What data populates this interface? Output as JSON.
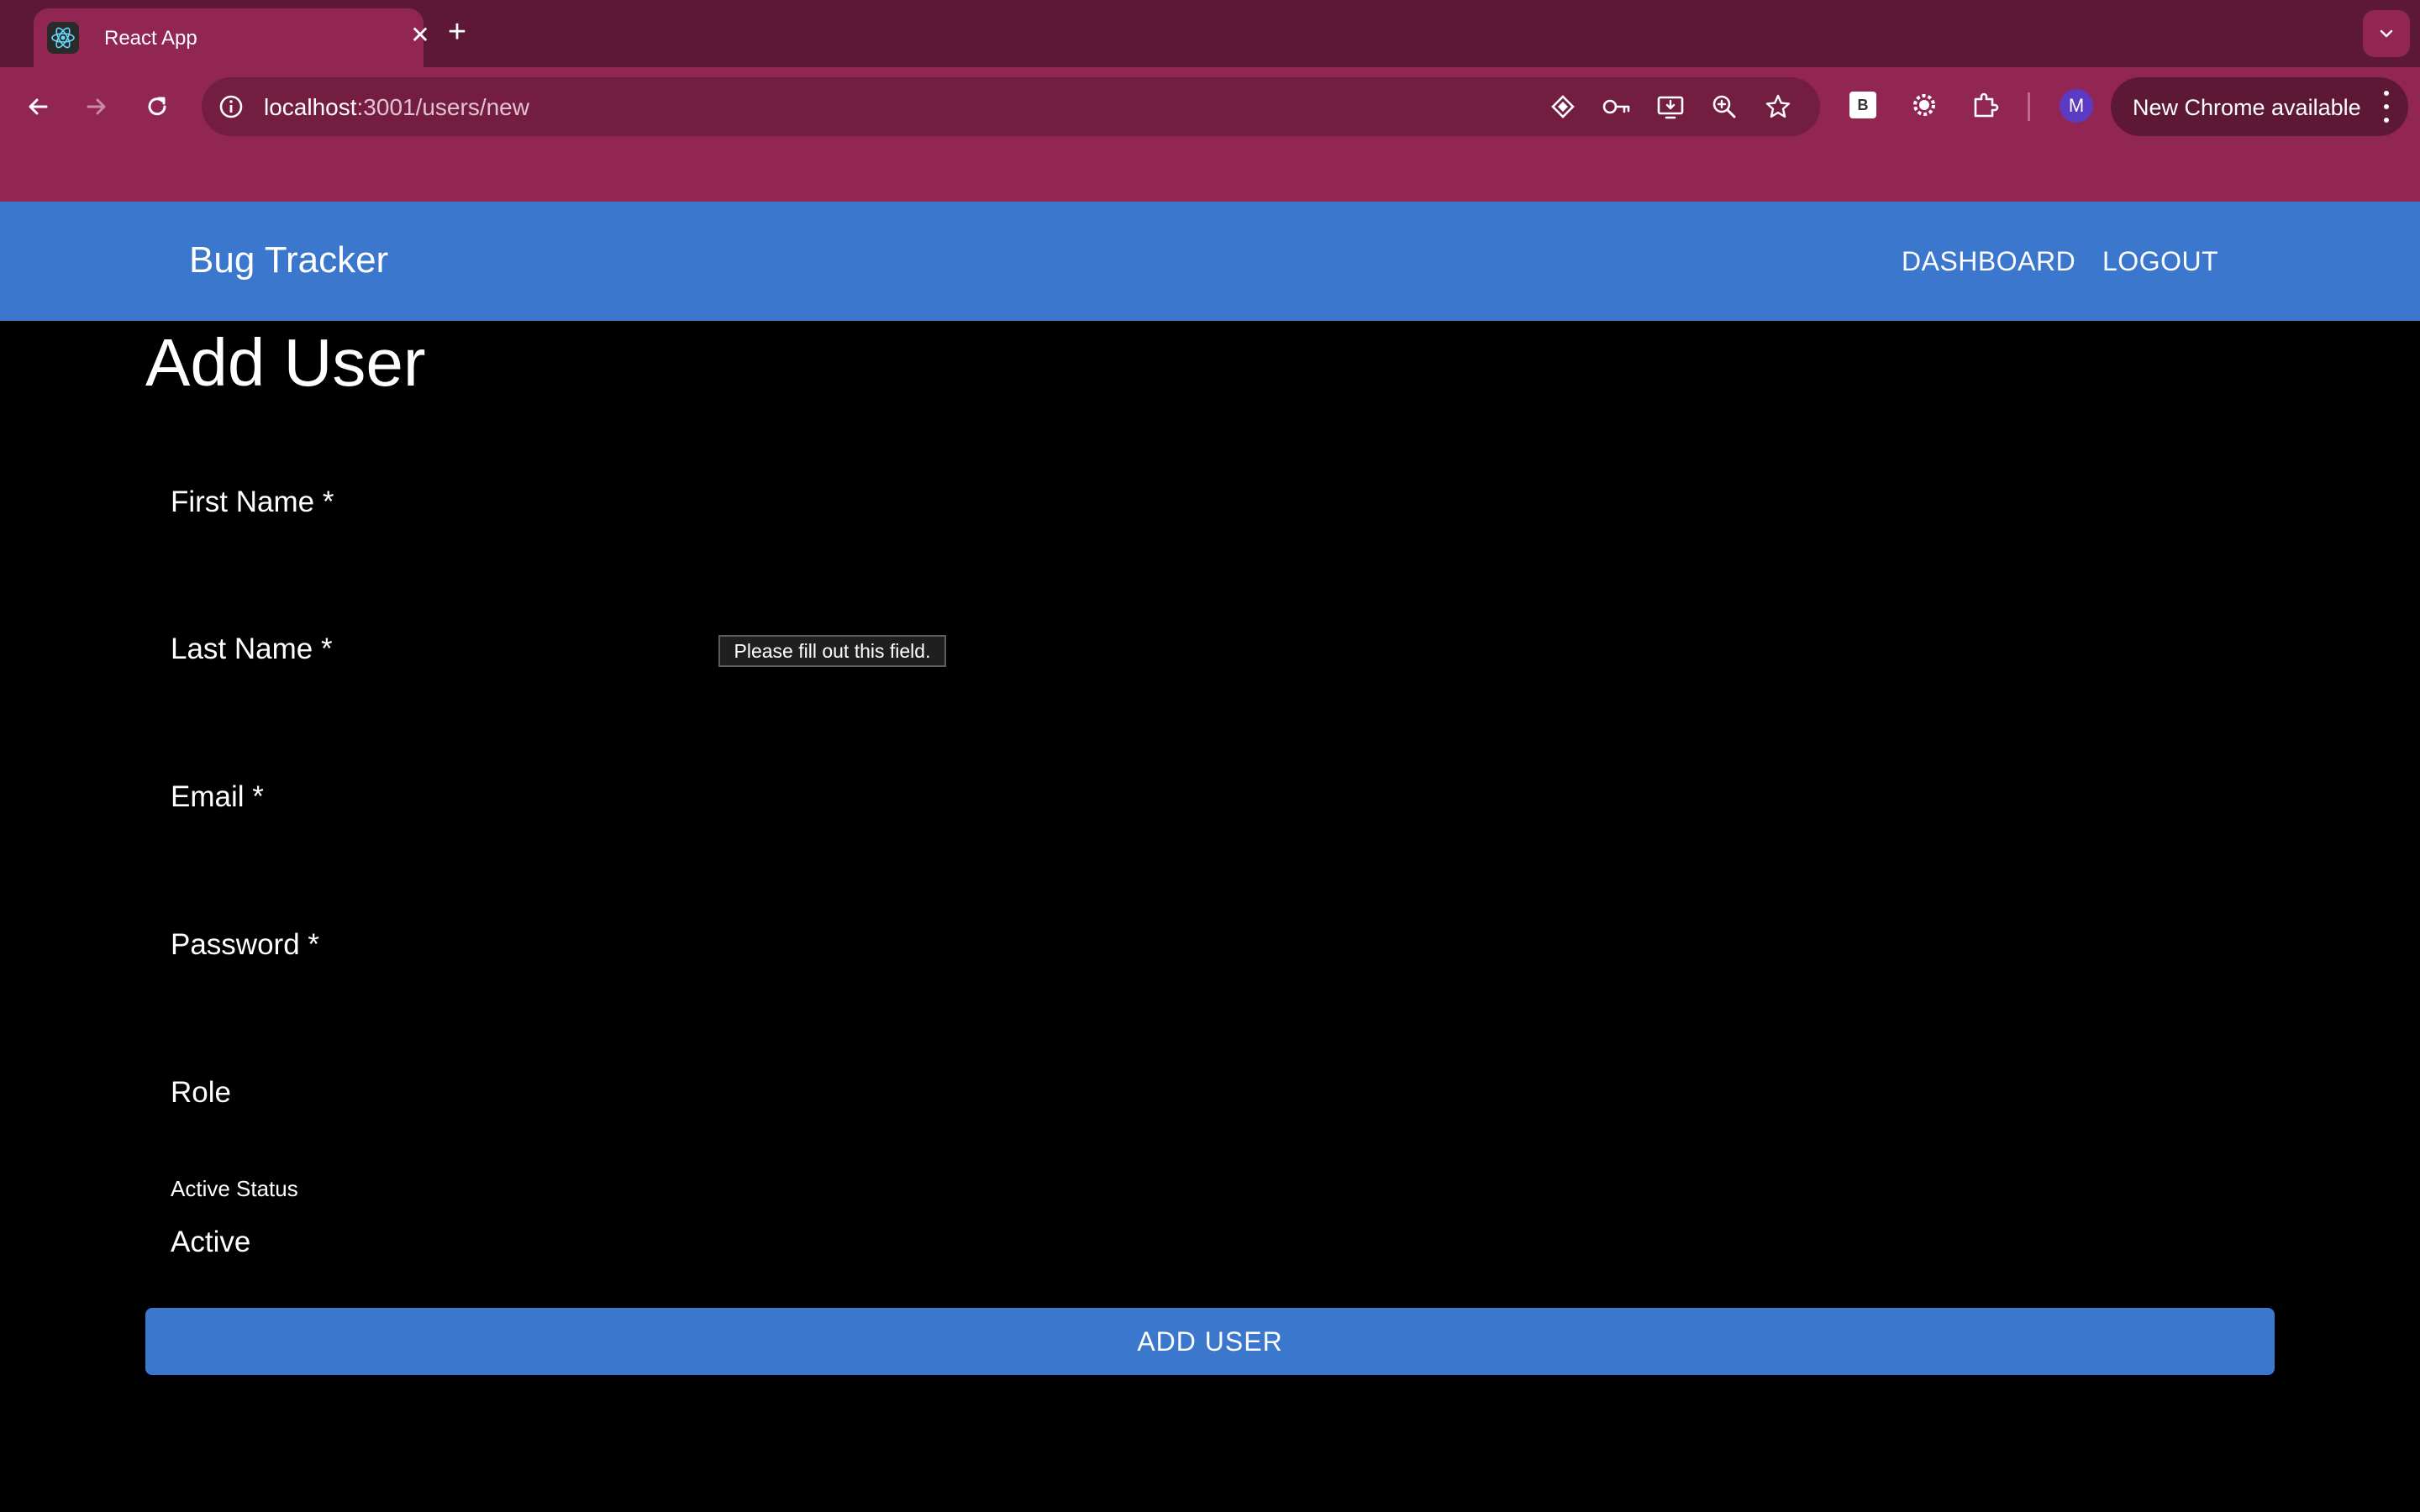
{
  "browser": {
    "tab": {
      "title": "React App"
    },
    "omnibox": {
      "host": "localhost",
      "rest": ":3001/users/new"
    },
    "profile_initial": "M",
    "extension_badge": "B",
    "update_chip": "New Chrome available"
  },
  "app": {
    "brand": "Bug Tracker",
    "nav": {
      "dashboard": "DASHBOARD",
      "logout": "LOGOUT"
    }
  },
  "page": {
    "title": "Add User",
    "fields": {
      "first_name": "First Name *",
      "last_name": "Last Name *",
      "email": "Email *",
      "password": "Password *",
      "role": "Role",
      "active_status_label": "Active Status",
      "active_status_value": "Active"
    },
    "validation_tooltip": "Please fill out this field.",
    "submit": "ADD USER"
  },
  "colors": {
    "tabstrip": "#5c1834",
    "toolbar": "#922652",
    "appbar": "#3a77cd",
    "background": "#000000"
  }
}
